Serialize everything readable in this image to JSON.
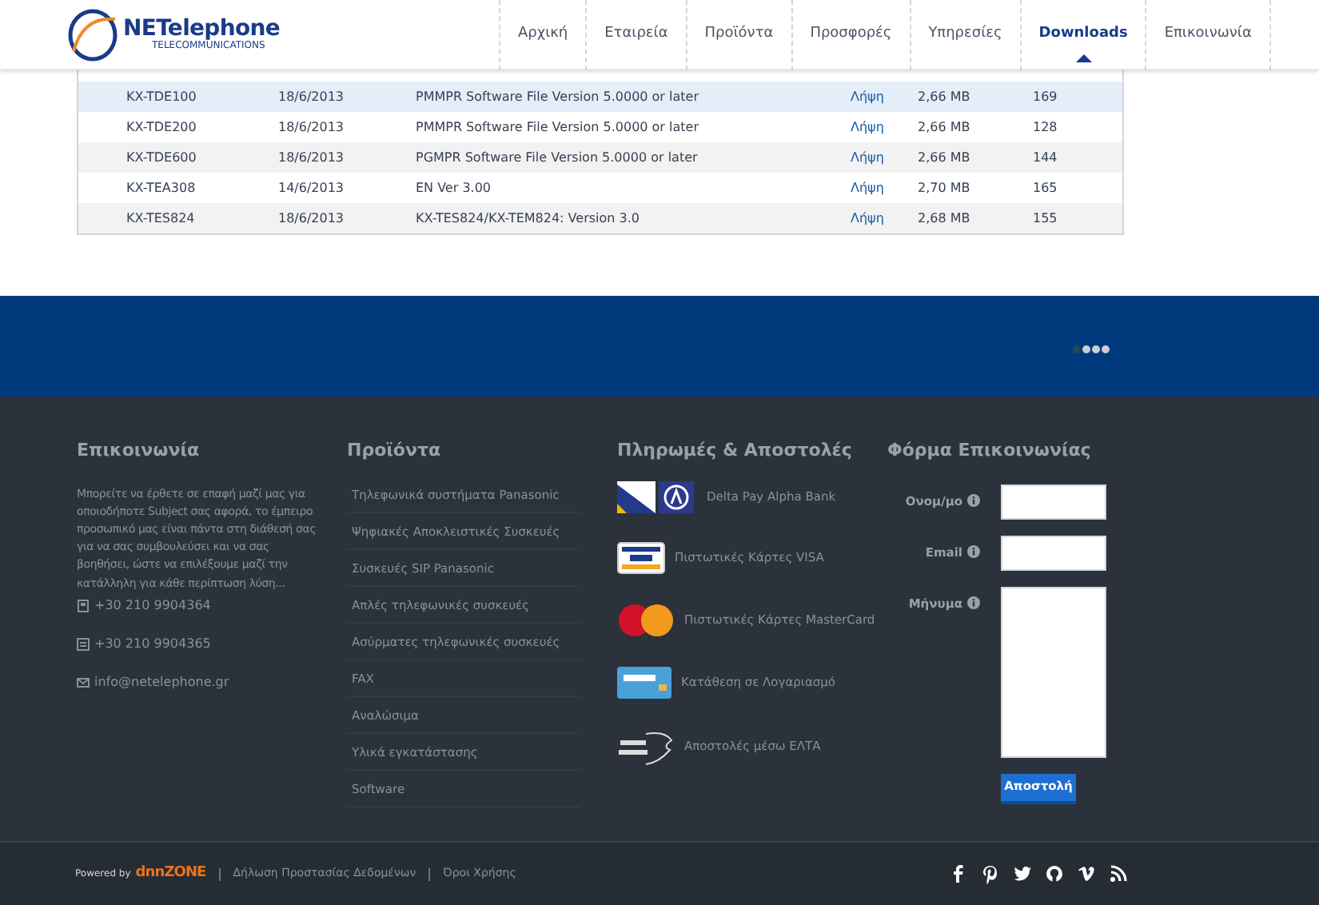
{
  "header": {
    "logo": {
      "name": "NETelephone",
      "tagline": "TELECOMMUNICATIONS"
    },
    "nav": [
      {
        "label": "Αρχική",
        "selected": false
      },
      {
        "label": "Εταιρεία",
        "selected": false
      },
      {
        "label": "Προϊόντα",
        "selected": false
      },
      {
        "label": "Προσφορές",
        "selected": false
      },
      {
        "label": "Υπηρεσίες",
        "selected": false
      },
      {
        "label": "Downloads",
        "selected": true
      },
      {
        "label": "Επικοινωνία",
        "selected": false
      }
    ]
  },
  "table": {
    "rows": [
      {
        "model": "KX-TDE100",
        "date": "18/6/2013",
        "description": "PMMPR Software File Version 5.0000 or later",
        "link": "Λήψη",
        "size": "2,66 MB",
        "count": "169",
        "selected": true
      },
      {
        "model": "KX-TDE200",
        "date": "18/6/2013",
        "description": "PMMPR Software File Version 5.0000 or later",
        "link": "Λήψη",
        "size": "2,66 MB",
        "count": "128",
        "selected": false
      },
      {
        "model": "KX-TDE600",
        "date": "18/6/2013",
        "description": "PGMPR Software File Version 5.0000 or later",
        "link": "Λήψη",
        "size": "2,66 MB",
        "count": "144",
        "selected": false
      },
      {
        "model": "KX-TEA308",
        "date": "14/6/2013",
        "description": "EN Ver 3.00",
        "link": "Λήψη",
        "size": "2,70 MB",
        "count": "165",
        "selected": false
      },
      {
        "model": "KX-TES824",
        "date": "18/6/2013",
        "description": "KX-TES824/KX-TEM824: Version 3.0",
        "link": "Λήψη",
        "size": "2,68 MB",
        "count": "155",
        "selected": false
      }
    ]
  },
  "carousel": {
    "dots": [
      {
        "selected": true
      },
      {
        "selected": false
      },
      {
        "selected": false
      },
      {
        "selected": false
      }
    ]
  },
  "footer": {
    "contact": {
      "title": "Επικοινωνία",
      "text": "Μπορείτε να έρθετε σε επαφή μαζί μας για οποιοδήποτε Subject σας αφορά, το έμπειρο προσωπικό μας είναι πάντα στη διάθεσή σας για να σας συμβουλεύσει και να σας βοηθήσει, ώστε να επιλέξουμε μαζί την κατάλληλη για κάθε περίπτωση λύση...",
      "items": [
        {
          "kind": "phone",
          "text": "+30 210 9904364"
        },
        {
          "kind": "fax",
          "text": "+30 210 9904365"
        },
        {
          "kind": "email",
          "text": "info@netelephone.gr"
        }
      ]
    },
    "products": {
      "title": "Προϊόντα",
      "items": [
        "Τηλεφωνικά συστήματα Panasonic",
        "Ψηφιακές Αποκλειστικές Συσκευές",
        "Συσκευές SIP Panasonic",
        "Απλές τηλεφωνικές συσκευές",
        "Ασύρματες τηλεφωνικές συσκευές",
        "FAX",
        "Αναλώσιμα",
        "Υλικά εγκατάστασης",
        "Software"
      ]
    },
    "payments": {
      "title": "Πληρωμές & Αποστολές",
      "items": [
        {
          "kind": "deltapay",
          "text": "Delta Pay Alpha Bank"
        },
        {
          "kind": "visa",
          "text": "Πιστωτικές Κάρτες VISA"
        },
        {
          "kind": "mastercard",
          "text": "Πιστωτικές Κάρτες MasterCard"
        },
        {
          "kind": "bank",
          "text": "Κατάθεση σε Λογαριασμό"
        },
        {
          "kind": "elta",
          "text": "Αποστολές μέσω ΕΛΤΑ"
        }
      ]
    },
    "form": {
      "title": "Φόρμα Επικοινωνίας",
      "fields": [
        {
          "kind": "input",
          "label": "Ονομ/μο"
        },
        {
          "kind": "input",
          "label": "Email"
        },
        {
          "kind": "textarea",
          "label": "Μήνυμα"
        }
      ],
      "submit": "Αποστολή"
    }
  },
  "bottom_bar": {
    "powered_by": "Powered by",
    "brand": "dnnZONE",
    "links": [
      "Δήλωση Προστασίας Δεδομένων",
      "Όροι Χρήσης"
    ],
    "social": [
      {
        "kind": "facebook"
      },
      {
        "kind": "pinterest"
      },
      {
        "kind": "twitter"
      },
      {
        "kind": "github"
      },
      {
        "kind": "vimeo"
      },
      {
        "kind": "rss"
      }
    ]
  }
}
